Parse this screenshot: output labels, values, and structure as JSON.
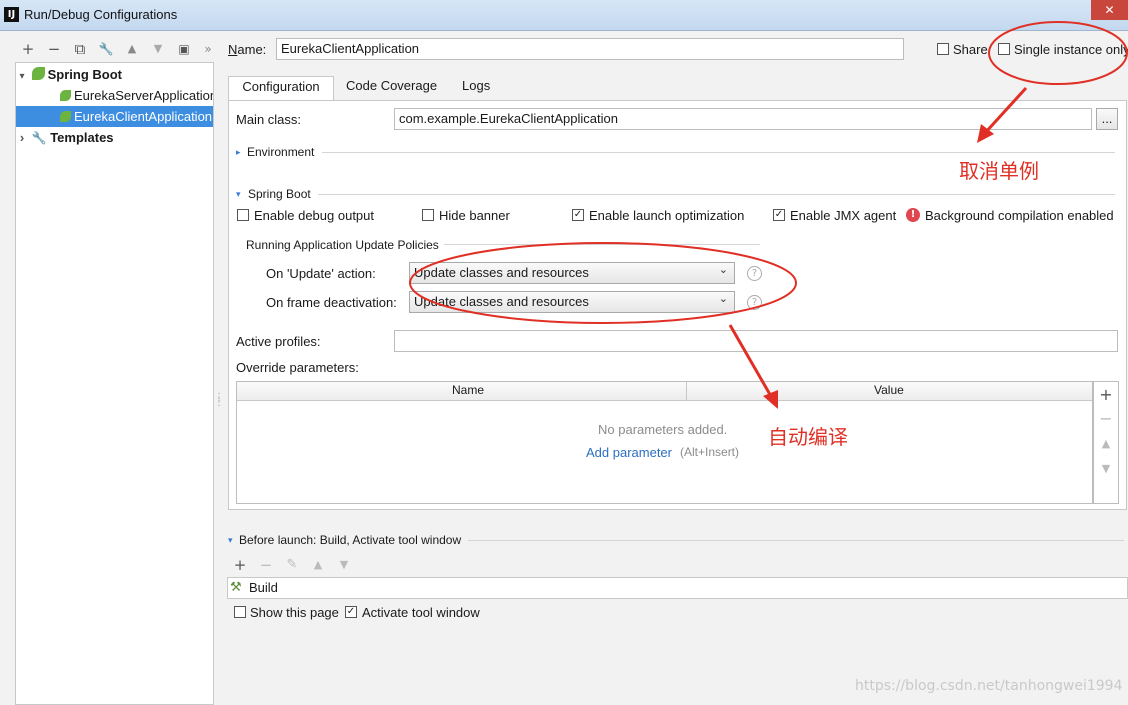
{
  "window": {
    "app_icon_text": "IJ",
    "title": "Run/Debug Configurations",
    "close_symbol": "✕"
  },
  "left_toolbar": [
    "+",
    "−",
    "⧉",
    "🔧",
    "▲",
    "▼",
    "▣",
    "»"
  ],
  "tree": {
    "items": [
      {
        "label": "Spring Boot",
        "expander": "▾"
      },
      {
        "label": "EurekaServerApplication"
      },
      {
        "label": "EurekaClientApplication"
      },
      {
        "label": "Templates",
        "expander": "›"
      }
    ]
  },
  "header": {
    "name_label": "Name:",
    "name_value": "EurekaClientApplication",
    "share_label": "Share",
    "single_instance_label": "Single instance only"
  },
  "tabs": [
    "Configuration",
    "Code Coverage",
    "Logs"
  ],
  "config": {
    "main_class_label": "Main class:",
    "main_class_value": "com.example.EurekaClientApplication",
    "browse_label": "...",
    "environment_label": "Environment",
    "spring_boot_label": "Spring Boot",
    "enable_debug_label": "Enable debug output",
    "hide_banner_label": "Hide banner",
    "launch_opt_label": "Enable launch optimization",
    "jmx_label": "Enable JMX agent",
    "bg_compile_label": "Background compilation enabled",
    "policies_label": "Running Application Update Policies",
    "on_update_label": "On 'Update' action:",
    "on_update_value": "Update classes and resources",
    "on_frame_label": "On frame deactivation:",
    "on_frame_value": "Update classes and resources",
    "active_profiles_label": "Active profiles:",
    "override_label": "Override parameters:",
    "col_name": "Name",
    "col_value": "Value",
    "no_params": "No parameters added.",
    "add_param": "Add parameter",
    "add_param_hint": "(Alt+Insert)"
  },
  "checkbox_states": {
    "share": false,
    "single_instance": false,
    "debug_output": false,
    "hide_banner": false,
    "launch_opt": true,
    "jmx": true,
    "show_page": false,
    "activate_tool": true
  },
  "before_launch": {
    "title": "Before launch: Build, Activate tool window",
    "tools": [
      "+",
      "−",
      "✎",
      "▲",
      "▼"
    ],
    "build_label": "Build",
    "show_page_label": "Show this page",
    "activate_label": "Activate tool window"
  },
  "annotations": {
    "cancel_singleton": "取消单例",
    "auto_compile": "自动编译"
  },
  "watermark": "https://blog.csdn.net/tanhongwei1994",
  "colors": {
    "annotation_red": "#e03025",
    "selection_blue": "#3d8de0",
    "spring_green": "#6db33f"
  }
}
